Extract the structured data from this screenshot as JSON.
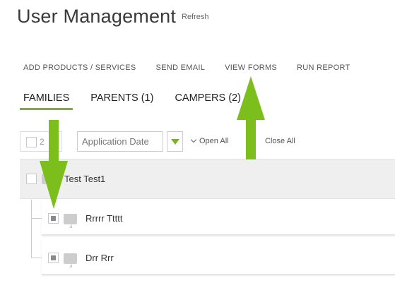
{
  "header": {
    "title": "User Management",
    "refresh_label": "Refresh"
  },
  "actions": [
    {
      "label": "ADD PRODUCTS / SERVICES"
    },
    {
      "label": "SEND EMAIL"
    },
    {
      "label": "VIEW FORMS"
    },
    {
      "label": "RUN REPORT"
    }
  ],
  "tabs": [
    {
      "label": "FAMILIES",
      "active": true
    },
    {
      "label": "PARENTS (1)",
      "active": false
    },
    {
      "label": "CAMPERS (2)",
      "active": false
    }
  ],
  "filters": {
    "selected_count": "2",
    "sort_value": "Application Date",
    "open_all_label": "Open All",
    "close_all_label": "Close All"
  },
  "family": {
    "name": "Test Test1",
    "checked": false
  },
  "campers": [
    {
      "name": "Rrrrr Ttttt",
      "checked": true
    },
    {
      "name": "Drr Rrr",
      "checked": true
    }
  ],
  "colors": {
    "accent": "#7ab421",
    "arrow": "#7cbf1c"
  }
}
